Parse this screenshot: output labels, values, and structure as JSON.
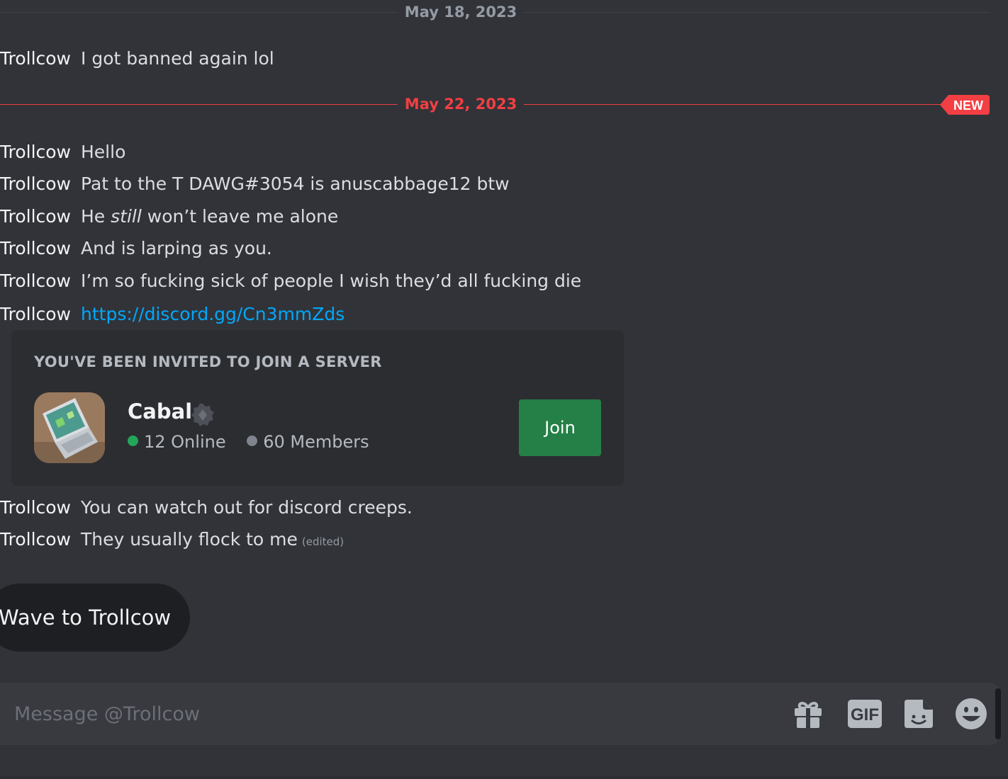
{
  "dividers": {
    "first": "May 18, 2023",
    "second": "May 22, 2023",
    "new_badge": "NEW"
  },
  "messages": [
    {
      "author": "Trollcow",
      "text": "I got banned again lol"
    },
    {
      "author": "Trollcow",
      "text": "Hello"
    },
    {
      "author": "Trollcow",
      "text": "Pat to the T DAWG#3054 is anuscabbage12 btw"
    },
    {
      "author": "Trollcow",
      "text_before": "He ",
      "text_italic": "still",
      "text_after": " won’t leave me alone"
    },
    {
      "author": "Trollcow",
      "text": "And is larping as you."
    },
    {
      "author": "Trollcow",
      "text": "I’m so fucking sick of people I wish they’d all fucking die"
    },
    {
      "author": "Trollcow",
      "link": "https://discord.gg/Cn3mmZds"
    },
    {
      "author": "Trollcow",
      "text": "You can watch out for discord creeps."
    },
    {
      "author": "Trollcow",
      "text": "They usually flock to me",
      "edited": "(edited)"
    }
  ],
  "invite": {
    "header": "YOU'VE BEEN INVITED TO JOIN A SERVER",
    "server_name": "Cabal",
    "online": "12 Online",
    "members": "60 Members",
    "join_label": "Join"
  },
  "wave_label": "Wave to Trollcow",
  "composer": {
    "placeholder": "Message @Trollcow",
    "gif_label": "GIF"
  },
  "colors": {
    "background": "#313338",
    "new_red": "#f23f43",
    "link": "#00a8fc",
    "join_green": "#248046",
    "online_green": "#23a55a"
  }
}
